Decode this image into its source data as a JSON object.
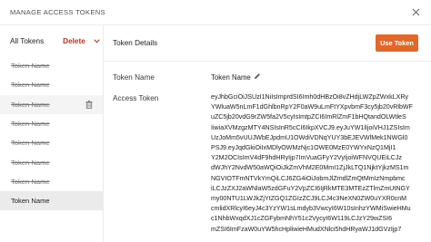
{
  "modal": {
    "title": "MANAGE ACCESS TOKENS"
  },
  "sidebar": {
    "all_tokens_label": "All Tokens",
    "delete_label": "Delete",
    "items": [
      {
        "label": "Token Name",
        "strikethrough": true,
        "state": "normal"
      },
      {
        "label": "Token Name",
        "strikethrough": true,
        "state": "normal"
      },
      {
        "label": "Token Name",
        "strikethrough": true,
        "state": "hover"
      },
      {
        "label": "Token Name",
        "strikethrough": true,
        "state": "normal"
      },
      {
        "label": "Token Name",
        "strikethrough": true,
        "state": "normal"
      },
      {
        "label": "Token Name",
        "strikethrough": true,
        "state": "normal"
      },
      {
        "label": "Token Name",
        "strikethrough": true,
        "state": "normal"
      },
      {
        "label": "Token Name",
        "strikethrough": false,
        "state": "selected"
      }
    ]
  },
  "details": {
    "title": "Token Details",
    "use_token_label": "Use Token",
    "token_name_label": "Token Name",
    "token_name_value": "Token Name",
    "access_token_label": "Access Token",
    "access_token_lines": [
      "eyJhbGciOiJSUzI1NiIsImprdSI6Imh0dHBzOi8vZHdjLWZpZWxkLXRy",
      "YWluaW5nLmF1dGhlbnRpY2F0aW9uLmFtYXpvbmF3cy5jb20vRlbWF",
      "uZC5jb20vdG9rZW5fa2V5cyIsImtpZCI6ImRlZmF1bHQtandOLWtleS",
      "IiwiaXVMzgzMTY4NSIsInR5cCI6IkpXVCJ9.eyJuYW1lIjoiVHJ1ZSIsIm",
      "UzJoMm5vUUJWbEJpdmU1OWdiVDNqYUY3bEJEVWlMek1NWGl0",
      "PSJ9.eyJqdGkiOiIxMDlyOWMzNjc1OWE0MzE0YWYxNzQ1MjI1",
      "Y2M2OCIsImV4dF9hdHRyIjp7ImVuaGFyY2VyIjoiWFNVQUEiLCJz",
      "dWJhY2NvdW50aWQiOiJkZmVhM2E0MmI1ZjJkLTQ1NjktYjkzMS1m",
      "NGVIOTFmNTVkYmQiLCJ6ZG4iOiJobmJlZmdlZmQtMmIzNmpbmc",
      "iLCJzZXJ2aWNlaW5zdGFuY2VpZCI6IjRkMTE3MTEzZTlmZmUtNGY",
      "my00NTU1LWJkZjYtZGQ1ZGIzZCJ9LCJ4c3NeXN0ZW0uYXR0cnM",
      "cmlidXRlcyI6eyJ4c3YzYW1sLmdyb3VwcyI6W10sInhzYWMiSwieHMu",
      "c1NhbWxqdXJ1cZGFybmNhY51c2VycyI6W119LCJzY29wZSI6",
      "mZSI6ImFzaW0uYW5hcHpliwieHMudXNlci5hdHRyaWJ1dGVzIjp7"
    ]
  }
}
